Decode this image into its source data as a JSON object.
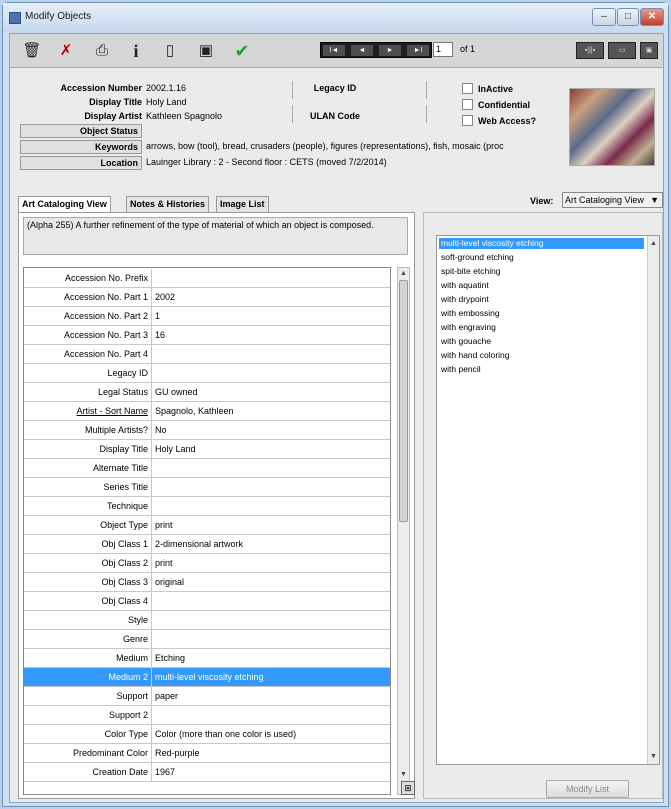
{
  "window": {
    "title": "Modify Objects",
    "minimize": "–",
    "maximize": "□",
    "close": "✕"
  },
  "toolbar": {
    "record_number": "1",
    "record_of": "of 1",
    "nav": [
      "I◄",
      "◄",
      "►",
      "►I"
    ],
    "right_buttons": [
      "▪|||▪",
      "▭",
      "▣"
    ]
  },
  "header": {
    "accession_number_label": "Accession Number",
    "accession_number": "2002.1.16",
    "display_title_label": "Display Title",
    "display_title": "Holy Land",
    "display_artist_label": "Display Artist",
    "display_artist": "Kathleen Spagnolo",
    "object_status_label": "Object Status",
    "keywords_label": "Keywords",
    "keywords": "arrows, bow (tool), bread, crusaders (people), figures (representations), fish, mosaic (proc",
    "location_label": "Location",
    "location": "Lauinger Library : 2 - Second floor : CETS (moved 7/2/2014)",
    "legacy_id_label": "Legacy ID",
    "ulan_code_label": "ULAN Code",
    "inactive_label": "InActive",
    "confidential_label": "Confidential",
    "web_access_label": "Web Access?"
  },
  "tabs": [
    {
      "label": "Art Cataloging View"
    },
    {
      "label": "Notes & Histories"
    },
    {
      "label": "Image List"
    }
  ],
  "view": {
    "label": "View:",
    "selected": "Art Cataloging View"
  },
  "description": "(Alpha 255) A further refinement of the type of material of which an object is composed.",
  "fields": [
    {
      "label": "Accession No. Prefix",
      "value": ""
    },
    {
      "label": "Accession No. Part 1",
      "value": "2002"
    },
    {
      "label": "Accession No. Part 2",
      "value": "1"
    },
    {
      "label": "Accession No. Part 3",
      "value": "16"
    },
    {
      "label": "Accession No. Part 4",
      "value": ""
    },
    {
      "label": "Legacy ID",
      "value": ""
    },
    {
      "label": "Legal Status",
      "value": "GU owned"
    },
    {
      "label": "Artist - Sort Name",
      "value": "Spagnolo, Kathleen"
    },
    {
      "label": "Multiple Artists?",
      "value": "No"
    },
    {
      "label": "Display Title",
      "value": "Holy Land"
    },
    {
      "label": "Alternate Title",
      "value": ""
    },
    {
      "label": "Series Title",
      "value": ""
    },
    {
      "label": "Technique",
      "value": ""
    },
    {
      "label": "Object Type",
      "value": "print"
    },
    {
      "label": "Obj Class 1",
      "value": "2-dimensional artwork"
    },
    {
      "label": "Obj Class 2",
      "value": "print"
    },
    {
      "label": "Obj Class 3",
      "value": "original"
    },
    {
      "label": "Obj Class 4",
      "value": ""
    },
    {
      "label": "Style",
      "value": ""
    },
    {
      "label": "Genre",
      "value": ""
    },
    {
      "label": "Medium",
      "value": "Etching"
    },
    {
      "label": "Medium 2",
      "value": "multi-level viscosity etching"
    },
    {
      "label": "Support",
      "value": "paper"
    },
    {
      "label": "Support 2",
      "value": ""
    },
    {
      "label": "Color Type",
      "value": "Color (more than one color is used)"
    },
    {
      "label": "Predominant Color",
      "value": "Red-purple"
    },
    {
      "label": "Creation Date",
      "value": "1967"
    }
  ],
  "list_items": [
    "multi-level viscosity etching",
    "soft-ground etching",
    "spit-bite etching",
    "with aquatint",
    "with drypoint",
    "with embossing",
    "with engraving",
    "with gouache",
    "with hand coloring",
    "with pencil"
  ],
  "modify_list_label": "Modify List"
}
